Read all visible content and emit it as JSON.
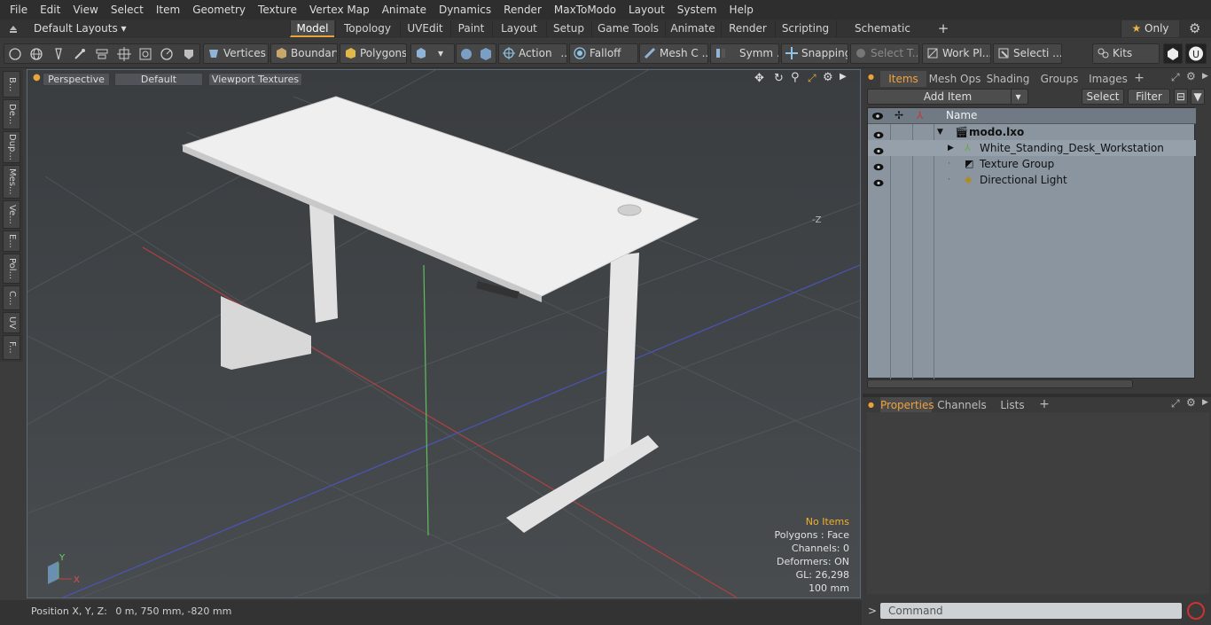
{
  "menu": [
    "File",
    "Edit",
    "View",
    "Select",
    "Item",
    "Geometry",
    "Texture",
    "Vertex Map",
    "Animate",
    "Dynamics",
    "Render",
    "MaxToModo",
    "Layout",
    "System",
    "Help"
  ],
  "layout_selector": "Default Layouts",
  "layout_tabs": [
    "Model",
    "Topology",
    "UVEdit",
    "Paint",
    "Layout",
    "Setup",
    "Game Tools",
    "Animate",
    "Render",
    "Scripting",
    "Schematic Fusion"
  ],
  "layout_tab_add": "+",
  "only_label": "Only",
  "toolbar": {
    "vertices": "Vertices",
    "boundary": "Boundary",
    "polygons": "Polygons",
    "action": "Action",
    "action_more": "...",
    "falloff": "Falloff",
    "mesh": "Mesh C ...",
    "symmetry": "Symm ...",
    "snapping": "Snapping",
    "select_t": "Select T...",
    "work_plane": "Work Pl...",
    "selection": "Selecti ...",
    "kits": "Kits"
  },
  "left_tabs": [
    "B...",
    "De...",
    "Dup...",
    "Mes...",
    "Ve...",
    "E...",
    "Pol...",
    "C...",
    "UV",
    "F..."
  ],
  "viewport": {
    "perspective": "Perspective",
    "default": "Default",
    "textures": "Viewport Textures",
    "axis_x_label": "X",
    "axis_y_label": "Y",
    "minus_z_label": "-Z",
    "info": {
      "no_items": "No Items",
      "polygons": "Polygons : Face",
      "channels": "Channels: 0",
      "deformers": "Deformers: ON",
      "gl": "GL: 26,298",
      "scale": "100 mm"
    }
  },
  "status": {
    "position_label": "Position X, Y, Z:",
    "position_value": "0 m, 750 mm, -820 mm"
  },
  "items_panel": {
    "tabs": [
      "Items",
      "Mesh Ops",
      "Shading",
      "Groups",
      "Images"
    ],
    "tab_add": "+",
    "add_item": "Add Item",
    "select": "Select",
    "filter": "Filter",
    "column_name": "Name",
    "rows": [
      {
        "label": "modo.lxo"
      },
      {
        "label": "White_Standing_Desk_Workstation"
      },
      {
        "label": "Texture Group"
      },
      {
        "label": "Directional Light"
      }
    ]
  },
  "props_panel": {
    "tabs": [
      "Properties",
      "Channels",
      "Lists"
    ],
    "tab_add": "+"
  },
  "command": {
    "prompt": ">",
    "placeholder": "Command"
  },
  "colors": {
    "accent": "#e8a33b",
    "viewport_border": "#5a6a78",
    "list_bg": "#8a959f"
  }
}
